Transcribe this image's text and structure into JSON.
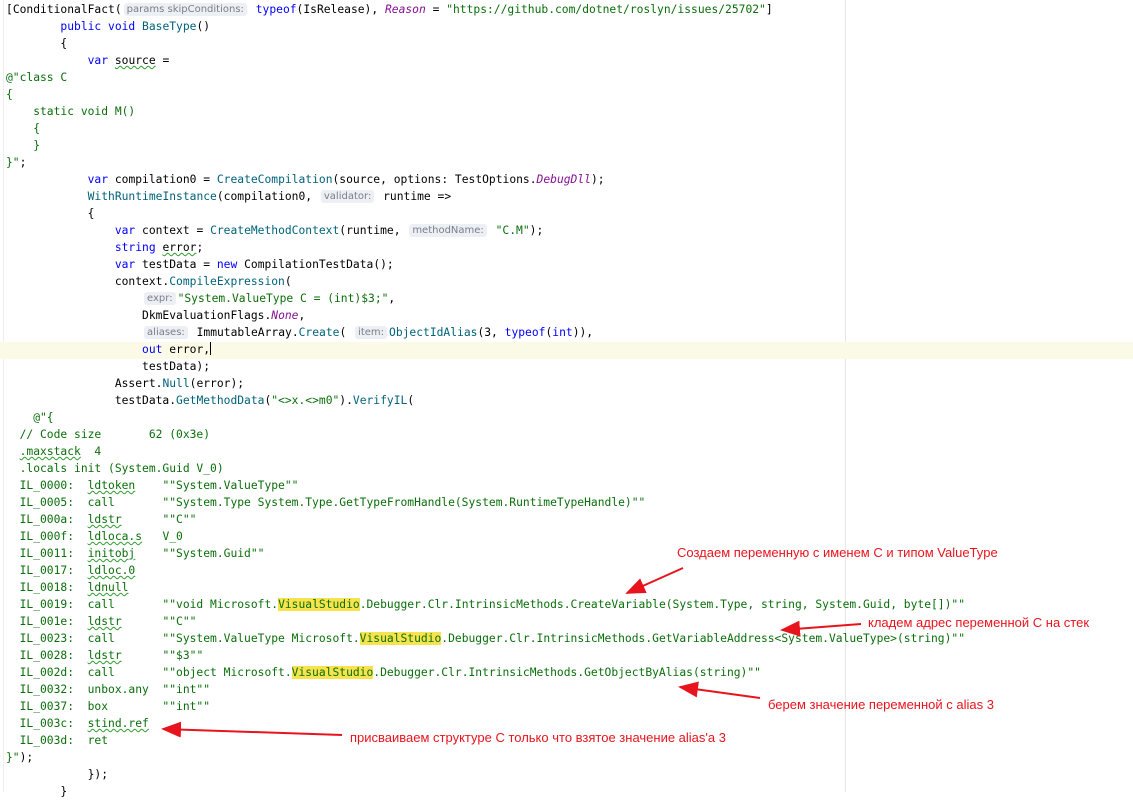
{
  "editor": {
    "lines": [
      {
        "segments": [
          [
            "",
            "["
          ],
          [
            "ty",
            "ConditionalFact("
          ],
          [
            "hint",
            "params skipConditions:"
          ],
          [
            "",
            " "
          ],
          [
            "kw",
            "typeof"
          ],
          [
            "",
            "(IsRelease), "
          ],
          [
            "en",
            "Reason"
          ],
          [
            "",
            " = "
          ],
          [
            "st",
            "\"https://github.com/dotnet/roslyn/issues/25702\""
          ],
          [
            "",
            "]"
          ]
        ]
      },
      {
        "segments": [
          [
            "",
            "        "
          ],
          [
            "kw",
            "public void "
          ],
          [
            "fn",
            "BaseType"
          ],
          [
            "",
            "()"
          ]
        ]
      },
      {
        "segments": [
          [
            "",
            "        {"
          ]
        ]
      },
      {
        "segments": [
          [
            "",
            "            "
          ],
          [
            "kw",
            "var "
          ],
          [
            "ul",
            "source"
          ],
          [
            "",
            " ="
          ]
        ]
      },
      {
        "segments": [
          [
            "st",
            "@\"class C"
          ]
        ]
      },
      {
        "segments": [
          [
            "st",
            "{"
          ]
        ]
      },
      {
        "segments": [
          [
            "st",
            "    static void M()"
          ]
        ]
      },
      {
        "segments": [
          [
            "st",
            "    {"
          ]
        ]
      },
      {
        "segments": [
          [
            "st",
            "    }"
          ]
        ]
      },
      {
        "segments": [
          [
            "st",
            "}\""
          ],
          [
            "",
            ";"
          ]
        ]
      },
      {
        "segments": [
          [
            "",
            "            "
          ],
          [
            "kw",
            "var "
          ],
          [
            "",
            "compilation0 = "
          ],
          [
            "fn",
            "CreateCompilation"
          ],
          [
            "",
            "(source, options: TestOptions."
          ],
          [
            "en",
            "DebugDll"
          ],
          [
            "",
            ");"
          ]
        ]
      },
      {
        "segments": [
          [
            "",
            "            "
          ],
          [
            "fn",
            "WithRuntimeInstance"
          ],
          [
            "",
            "(compilation0, "
          ],
          [
            "hint",
            "validator:"
          ],
          [
            "",
            " runtime =>"
          ]
        ]
      },
      {
        "segments": [
          [
            "",
            "            {"
          ]
        ]
      },
      {
        "segments": [
          [
            "",
            "                "
          ],
          [
            "kw",
            "var "
          ],
          [
            "",
            "context = "
          ],
          [
            "fn",
            "CreateMethodContext"
          ],
          [
            "",
            "(runtime, "
          ],
          [
            "hint",
            "methodName:"
          ],
          [
            "",
            " "
          ],
          [
            "st",
            "\"C.M\""
          ],
          [
            "",
            ");"
          ]
        ]
      },
      {
        "segments": [
          [
            "",
            "                "
          ],
          [
            "kw",
            "string "
          ],
          [
            "ul",
            "error"
          ],
          [
            "",
            ";"
          ]
        ]
      },
      {
        "segments": [
          [
            "",
            "                "
          ],
          [
            "kw",
            "var "
          ],
          [
            "",
            "testData = "
          ],
          [
            "kw",
            "new "
          ],
          [
            "",
            "CompilationTestData();"
          ]
        ]
      },
      {
        "segments": [
          [
            "",
            "                context."
          ],
          [
            "fn",
            "CompileExpression"
          ],
          [
            "",
            "("
          ]
        ]
      },
      {
        "segments": [
          [
            "",
            "                    "
          ],
          [
            "hint",
            "expr:"
          ],
          [
            "",
            ""
          ],
          [
            "st",
            "\"System.ValueType C = (int)$3;\""
          ],
          [
            "",
            ","
          ]
        ]
      },
      {
        "segments": [
          [
            "",
            "                    DkmEvaluationFlags."
          ],
          [
            "en",
            "None"
          ],
          [
            "",
            ","
          ]
        ]
      },
      {
        "segments": [
          [
            "",
            "                    "
          ],
          [
            "hint",
            "aliases:"
          ],
          [
            "",
            " ImmutableArray."
          ],
          [
            "fn",
            "Create"
          ],
          [
            "",
            "( "
          ],
          [
            "hint",
            "item:"
          ],
          [
            "",
            ""
          ],
          [
            "fn",
            "ObjectIdAlias"
          ],
          [
            "",
            "(3, "
          ],
          [
            "kw",
            "typeof"
          ],
          [
            "",
            "("
          ],
          [
            "kw",
            "int"
          ],
          [
            "",
            ")),"
          ]
        ]
      },
      {
        "segments": [
          [
            "",
            "                    "
          ],
          [
            "kw",
            "out "
          ],
          [
            "",
            "error,"
          ],
          [
            "caret",
            ""
          ]
        ]
      },
      {
        "segments": [
          [
            "",
            "                    testData);"
          ]
        ]
      },
      {
        "segments": [
          [
            "",
            "                Assert."
          ],
          [
            "fn",
            "Null"
          ],
          [
            "",
            "(error);"
          ]
        ]
      },
      {
        "segments": [
          [
            "",
            "                testData."
          ],
          [
            "fn",
            "GetMethodData"
          ],
          [
            "",
            "("
          ],
          [
            "st",
            "\"<>x.<>m0\""
          ],
          [
            "",
            ")."
          ],
          [
            "fn",
            "VerifyIL"
          ],
          [
            "",
            "("
          ]
        ]
      },
      {
        "segments": [
          [
            "st",
            "    @\"{"
          ]
        ]
      },
      {
        "segments": [
          [
            "st",
            "  // Code size       62 (0x3e)"
          ]
        ]
      },
      {
        "segments": [
          [
            "st",
            "  "
          ],
          [
            "stul",
            ".maxstack"
          ],
          [
            "st",
            "  4"
          ]
        ]
      },
      {
        "segments": [
          [
            "st",
            "  .locals init (System.Guid V_0)"
          ]
        ]
      },
      {
        "segments": [
          [
            "st",
            "  IL_0000:  "
          ],
          [
            "stul",
            "ldtoken"
          ],
          [
            "st",
            "    \"\"System.ValueType\"\""
          ]
        ]
      },
      {
        "segments": [
          [
            "st",
            "  IL_0005:  call       \"\"System.Type System.Type.GetTypeFromHandle(System.RuntimeTypeHandle)\"\""
          ]
        ]
      },
      {
        "segments": [
          [
            "st",
            "  IL_000a:  "
          ],
          [
            "stul",
            "ldstr"
          ],
          [
            "st",
            "      \"\"C\"\""
          ]
        ]
      },
      {
        "segments": [
          [
            "st",
            "  IL_000f:  "
          ],
          [
            "stul",
            "ldloca.s"
          ],
          [
            "st",
            "   V_0"
          ]
        ]
      },
      {
        "segments": [
          [
            "st",
            "  IL_0011:  "
          ],
          [
            "stul",
            "initobj"
          ],
          [
            "st",
            "    \"\"System.Guid\"\""
          ]
        ]
      },
      {
        "segments": [
          [
            "st",
            "  IL_0017:  "
          ],
          [
            "stul",
            "ldloc.0"
          ]
        ]
      },
      {
        "segments": [
          [
            "st",
            "  IL_0018:  "
          ],
          [
            "stul",
            "ldnull"
          ]
        ]
      },
      {
        "segments": [
          [
            "st",
            "  IL_0019:  call       \"\"void Microsoft."
          ],
          [
            "sthl",
            "VisualStudio"
          ],
          [
            "st",
            ".Debugger.Clr.IntrinsicMethods.CreateVariable(System.Type, string, System.Guid, byte[])\"\""
          ]
        ]
      },
      {
        "segments": [
          [
            "st",
            "  IL_001e:  "
          ],
          [
            "stul",
            "ldstr"
          ],
          [
            "st",
            "      \"\"C\"\""
          ]
        ]
      },
      {
        "segments": [
          [
            "st",
            "  IL_0023:  call       \"\"System.ValueType Microsoft."
          ],
          [
            "sthl",
            "VisualStudio"
          ],
          [
            "st",
            ".Debugger.Clr.IntrinsicMethods.GetVariableAddress<System.ValueType>(string)\"\""
          ]
        ]
      },
      {
        "segments": [
          [
            "st",
            "  IL_0028:  "
          ],
          [
            "stul",
            "ldstr"
          ],
          [
            "st",
            "      \"\"$3\"\""
          ]
        ]
      },
      {
        "segments": [
          [
            "st",
            "  IL_002d:  call       \"\"object Microsoft."
          ],
          [
            "sthl",
            "VisualStudio"
          ],
          [
            "st",
            ".Debugger.Clr.IntrinsicMethods.GetObjectByAlias(string)\"\""
          ]
        ]
      },
      {
        "segments": [
          [
            "st",
            "  IL_0032:  unbox.any  \"\"int\"\""
          ]
        ]
      },
      {
        "segments": [
          [
            "st",
            "  IL_0037:  box        \"\"int\"\""
          ]
        ]
      },
      {
        "segments": [
          [
            "st",
            "  IL_003c:  "
          ],
          [
            "stul",
            "stind.ref"
          ]
        ]
      },
      {
        "segments": [
          [
            "st",
            "  IL_003d:  ret"
          ]
        ]
      },
      {
        "segments": [
          [
            "st",
            "}\""
          ],
          [
            "",
            ");"
          ]
        ]
      },
      {
        "segments": [
          [
            "",
            "            });"
          ]
        ]
      },
      {
        "segments": [
          [
            "",
            "        }"
          ]
        ]
      }
    ]
  },
  "annotations": {
    "create_variable": "Создаем переменную с именем С и типом ValueType",
    "push_address": "кладем адрес переменной С на стек",
    "get_alias": "берем значение переменной с alias 3",
    "assign": "присваиваем структуре С только что взятое значение alias'a 3"
  },
  "colors": {
    "annotation": "#e8141d",
    "keyword": "#0000ff",
    "string": "#0b6e0b",
    "highlight": "#f7e34d"
  }
}
